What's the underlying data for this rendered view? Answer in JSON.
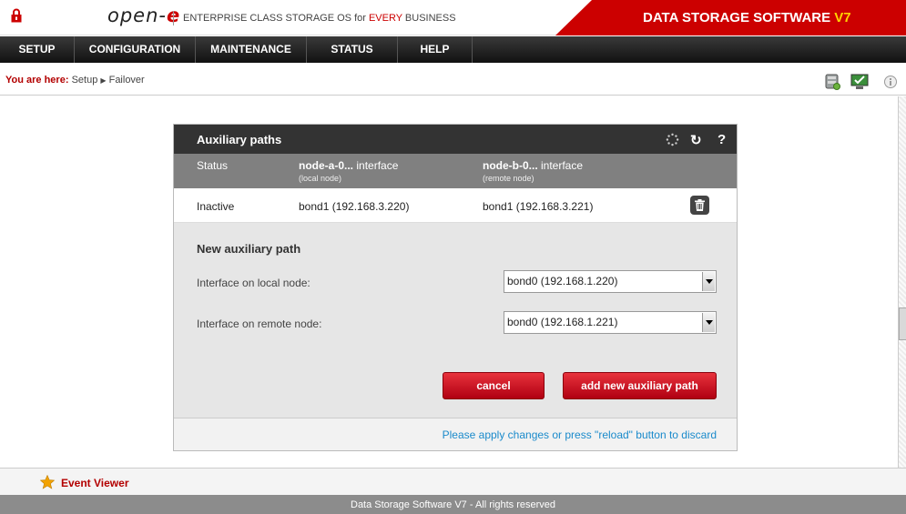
{
  "header": {
    "logo_text": "open-",
    "logo_e": "e",
    "tagline_prefix": "ENTERPRISE CLASS STORAGE OS for ",
    "tagline_hl": "EVERY",
    "tagline_suffix": " BUSINESS",
    "brand_text": "DATA STORAGE SOFTWARE ",
    "brand_version": "V7",
    "brand_color": "#cc0000"
  },
  "nav": {
    "items": [
      {
        "label": "SETUP"
      },
      {
        "label": "CONFIGURATION"
      },
      {
        "label": "MAINTENANCE"
      },
      {
        "label": "STATUS"
      },
      {
        "label": "HELP"
      }
    ]
  },
  "breadcrumb": {
    "label": "You are here:",
    "path_1": "Setup",
    "path_2": "Failover"
  },
  "panel": {
    "title": "Auxiliary paths",
    "header_icons": [
      "spinner-icon",
      "reload-icon",
      "help-icon"
    ],
    "columns": {
      "status": "Status",
      "local_name": "node-a-0...",
      "local_suffix": " interface",
      "local_sub": "(local node)",
      "remote_name": "node-b-0...",
      "remote_suffix": " interface",
      "remote_sub": "(remote node)"
    },
    "rows": [
      {
        "status": "Inactive",
        "local": "bond1 (192.168.3.220)",
        "remote": "bond1 (192.168.3.221)"
      }
    ],
    "form": {
      "title": "New auxiliary path",
      "local_label": "Interface on local node:",
      "local_value": "bond0 (192.168.1.220)",
      "remote_label": "Interface on remote node:",
      "remote_value": "bond0 (192.168.1.221)",
      "cancel_label": "cancel",
      "add_label": "add new auxiliary path"
    },
    "footer_note": "Please apply changes or press \"reload\" button to discard"
  },
  "event_viewer": {
    "label": "Event Viewer"
  },
  "status_bar": {
    "text": "Data Storage Software V7 - All rights reserved"
  }
}
